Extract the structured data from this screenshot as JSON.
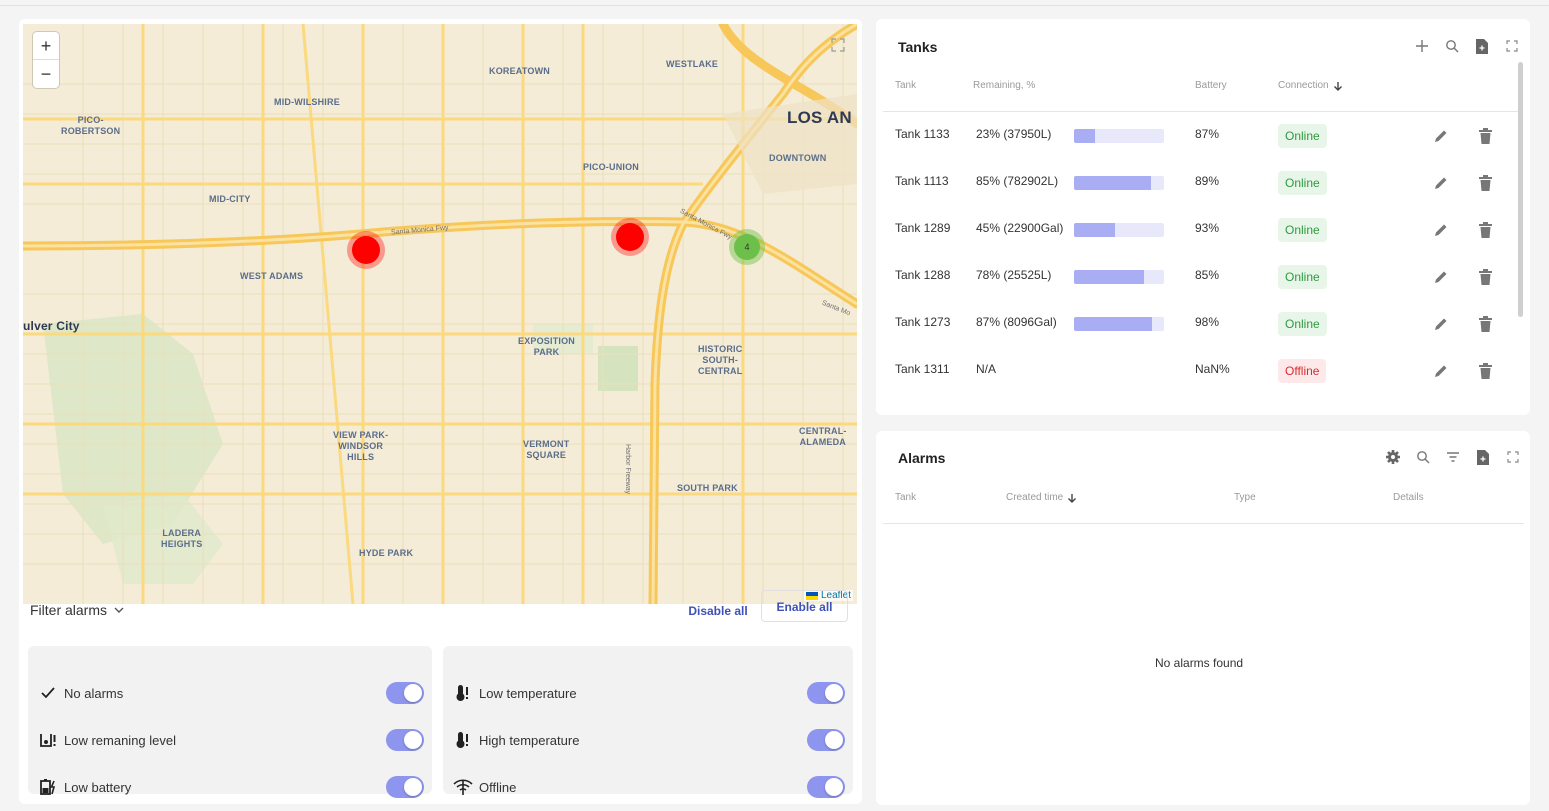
{
  "map": {
    "zoom_in": "+",
    "zoom_out": "−",
    "attribution": "Leaflet",
    "labels": {
      "koreatown": "KOREATOWN",
      "westlake": "WESTLAKE",
      "mid_wilshire": "MID-WILSHIRE",
      "pico_robertson": "PICO-\nROBERTSON",
      "los_angeles": "LOS AN",
      "downtown": "DOWNTOWN",
      "pico_union": "PICO-UNION",
      "mid_city": "MID-CITY",
      "west_adams": "WEST ADAMS",
      "culver_city": "ulver City",
      "exposition_park": "EXPOSITION\nPARK",
      "historic_south_central": "HISTORIC\nSOUTH-\nCENTRAL",
      "view_park": "VIEW PARK-\nWINDSOR\nHILLS",
      "vermont_square": "VERMONT\nSQUARE",
      "central_alameda": "CENTRAL-\nALAMEDA",
      "south_park": "SOUTH PARK",
      "ladera_heights": "LADERA\nHEIGHTS",
      "hyde_park": "HYDE PARK",
      "santa_monica_fwy_1": "Santa Monica Fwy",
      "santa_monica_fwy_2": "Santa Monica Fwy",
      "santa_mo": "Santa Mo",
      "harbor_freeway": "Harbor Freeway"
    },
    "clusters": [
      {
        "label": "",
        "color": "#ff0000"
      },
      {
        "label": "",
        "color": "#ff0000"
      },
      {
        "label": "4",
        "color": "#6cc04a"
      }
    ]
  },
  "filter": {
    "title": "Filter alarms",
    "disable_all": "Disable all",
    "enable_all": "Enable all",
    "items": [
      {
        "label": "No alarms",
        "icon": "check-icon",
        "enabled": true
      },
      {
        "label": "Low remaning level",
        "icon": "low-level-icon",
        "enabled": true
      },
      {
        "label": "Low battery",
        "icon": "battery-charging-icon",
        "enabled": true
      },
      {
        "label": "Low temperature",
        "icon": "thermometer-alert-icon",
        "enabled": true
      },
      {
        "label": "High temperature",
        "icon": "thermometer-alert-icon",
        "enabled": true
      },
      {
        "label": "Offline",
        "icon": "wifi-off-icon",
        "enabled": true
      }
    ]
  },
  "tanks": {
    "title": "Tanks",
    "headers": {
      "tank": "Tank",
      "remaining": "Remaining, %",
      "battery": "Battery",
      "connection": "Connection"
    },
    "rows": [
      {
        "name": "Tank 1133",
        "remaining": "23% (37950L)",
        "level": 0.23,
        "battery": "87%",
        "status": "Online"
      },
      {
        "name": "Tank 1113",
        "remaining": "85% (782902L)",
        "level": 0.85,
        "battery": "89%",
        "status": "Online"
      },
      {
        "name": "Tank 1289",
        "remaining": "45% (22900Gal)",
        "level": 0.45,
        "battery": "93%",
        "status": "Online"
      },
      {
        "name": "Tank 1288",
        "remaining": "78% (25525L)",
        "level": 0.78,
        "battery": "85%",
        "status": "Online"
      },
      {
        "name": "Tank 1273",
        "remaining": "87% (8096Gal)",
        "level": 0.87,
        "battery": "98%",
        "status": "Online"
      },
      {
        "name": "Tank 1311",
        "remaining": "N/A",
        "level": null,
        "battery": "NaN%",
        "status": "Offline"
      }
    ]
  },
  "alarms": {
    "title": "Alarms",
    "headers": {
      "tank": "Tank",
      "created": "Created time",
      "type": "Type",
      "details": "Details"
    },
    "empty": "No alarms found"
  },
  "colors": {
    "accent": "#3f51b5",
    "toggle": "#8d95ee",
    "online": "#2e9a3e",
    "offline": "#d32f2f"
  }
}
